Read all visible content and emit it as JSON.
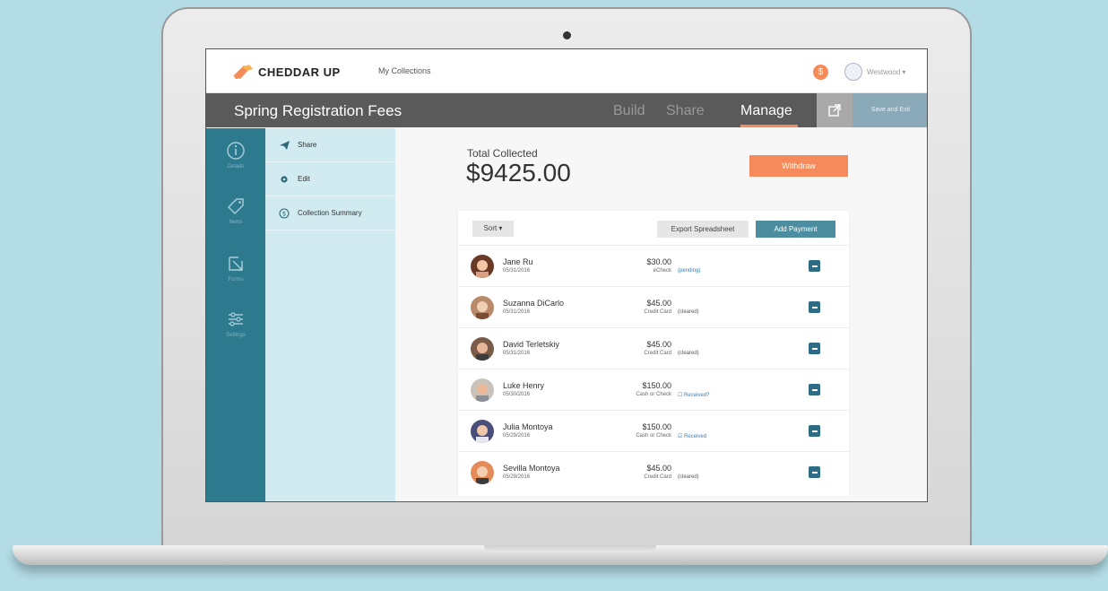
{
  "brand": {
    "name": "CHEDDAR UP",
    "accent": "#f58b5b",
    "rail_color": "#2d7a8f"
  },
  "topbar": {
    "my_collections": "My Collections",
    "coin_symbol": "$",
    "user_name": "Westwood ▾"
  },
  "titlebar": {
    "title": "Spring Registration Fees",
    "tabs": [
      {
        "label": "Build"
      },
      {
        "label": "Share"
      },
      {
        "label": "Manage"
      }
    ],
    "external_icon": "external-link-icon",
    "save_exit": "Save and Exit"
  },
  "rail": {
    "items": [
      {
        "label": "Details",
        "icon": "info-icon"
      },
      {
        "label": "Items",
        "icon": "tag-icon"
      },
      {
        "label": "Forms",
        "icon": "form-icon"
      },
      {
        "label": "Settings",
        "icon": "sliders-icon"
      }
    ]
  },
  "subnav": {
    "items": [
      {
        "label": "Share",
        "icon": "paper-plane-icon"
      },
      {
        "label": "Edit",
        "icon": "gear-icon"
      },
      {
        "label": "Collection Summary",
        "icon": "dollar-icon"
      }
    ]
  },
  "main": {
    "total_label": "Total Collected",
    "total_amount": "$9425.00",
    "withdraw": "Withdraw",
    "sort": "Sort ▾",
    "export": "Export Spreadsheet",
    "add_payment": "Add Payment",
    "payments": [
      {
        "name": "Jane Ru",
        "date": "05/31/2016",
        "amount": "$30.00",
        "method": "eCheck",
        "status": "(pending)"
      },
      {
        "name": "Suzanna DiCarlo",
        "date": "05/31/2016",
        "amount": "$45.00",
        "method": "Credit Card",
        "status": "(cleared)"
      },
      {
        "name": "David Terletskiy",
        "date": "05/31/2016",
        "amount": "$45.00",
        "method": "Credit Card",
        "status": "(cleared)"
      },
      {
        "name": "Luke Henry",
        "date": "05/30/2016",
        "amount": "$150.00",
        "method": "Cash or Check",
        "status": "☐ Received?"
      },
      {
        "name": "Julia Montoya",
        "date": "05/29/2016",
        "amount": "$150.00",
        "method": "Cash or Check",
        "status": "☑ Received"
      },
      {
        "name": "Sevilla Montoya",
        "date": "05/29/2016",
        "amount": "$45.00",
        "method": "Credit Card",
        "status": "(cleared)"
      }
    ]
  }
}
